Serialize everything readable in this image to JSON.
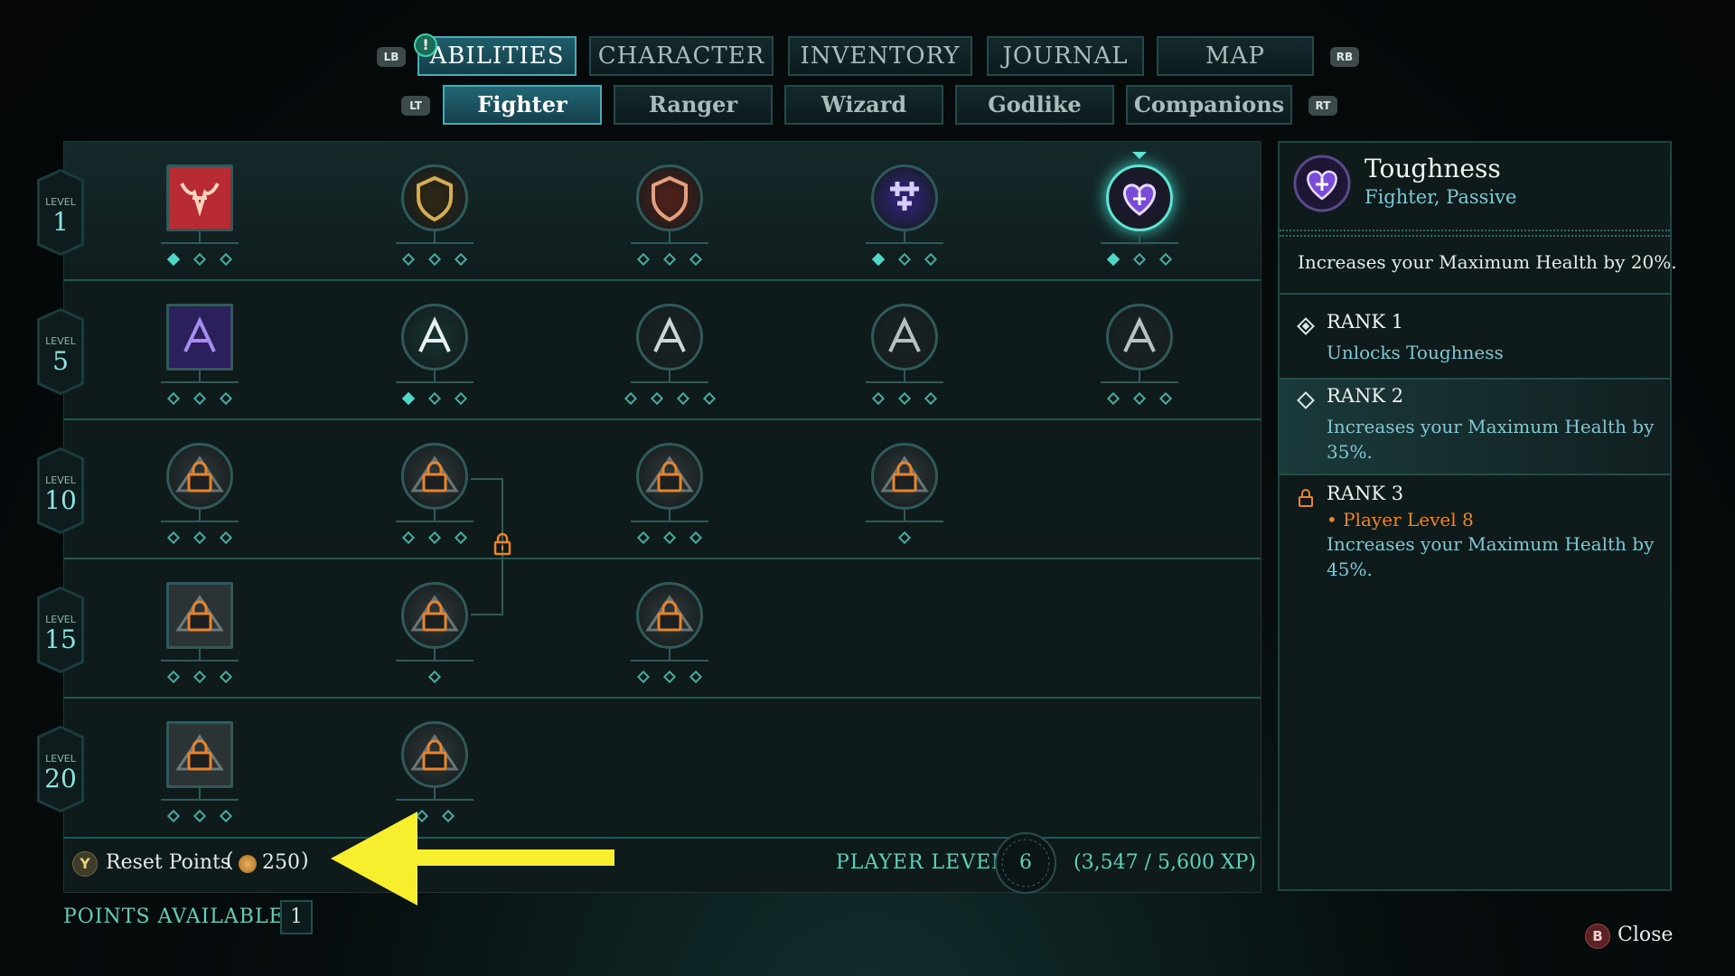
{
  "top_tabs": {
    "lb": "LB",
    "rb": "RB",
    "notification": "!",
    "items": [
      {
        "label": "ABILITIES",
        "active": true
      },
      {
        "label": "CHARACTER",
        "active": false
      },
      {
        "label": "INVENTORY",
        "active": false
      },
      {
        "label": "JOURNAL",
        "active": false
      },
      {
        "label": "MAP",
        "active": false
      }
    ]
  },
  "sub_tabs": {
    "lt": "LT",
    "rt": "RT",
    "items": [
      {
        "label": "Fighter",
        "active": true
      },
      {
        "label": "Ranger",
        "active": false
      },
      {
        "label": "Wizard",
        "active": false
      },
      {
        "label": "Godlike",
        "active": false
      },
      {
        "label": "Companions",
        "active": false
      }
    ]
  },
  "levels": [
    {
      "word": "LEVEL",
      "num": "1"
    },
    {
      "word": "LEVEL",
      "num": "5"
    },
    {
      "word": "LEVEL",
      "num": "10"
    },
    {
      "word": "LEVEL",
      "num": "15"
    },
    {
      "word": "LEVEL",
      "num": "20"
    }
  ],
  "abilities": [
    {
      "icon": "bull-rage-icon",
      "shape": "square",
      "ranks": 3,
      "filled": 1,
      "locked": false
    },
    {
      "icon": "golden-shield-icon",
      "shape": "circle",
      "ranks": 3,
      "filled": 0,
      "locked": false
    },
    {
      "icon": "shield-bash-icon",
      "shape": "circle",
      "ranks": 3,
      "filled": 0,
      "locked": false
    },
    {
      "icon": "purple-crosses-icon",
      "shape": "circle",
      "ranks": 3,
      "filled": 1,
      "locked": false
    },
    {
      "icon": "heart-toughness-icon",
      "shape": "circle",
      "ranks": 3,
      "filled": 1,
      "locked": false,
      "selected": true
    },
    {
      "icon": "purple-dash-icon",
      "shape": "square",
      "ranks": 3,
      "filled": 0,
      "locked": false
    },
    {
      "icon": "torn-banner-icon",
      "shape": "circle",
      "ranks": 3,
      "filled": 1,
      "locked": false
    },
    {
      "icon": "fist-strike-icon",
      "shape": "circle",
      "ranks": 4,
      "filled": 0,
      "locked": false
    },
    {
      "icon": "skull-sword-icon",
      "shape": "circle",
      "ranks": 3,
      "filled": 0,
      "locked": false
    },
    {
      "icon": "double-axe-icon",
      "shape": "circle",
      "ranks": 3,
      "filled": 0,
      "locked": false
    },
    {
      "icon": "locked-ability-icon",
      "shape": "circle",
      "ranks": 3,
      "filled": 0,
      "locked": true
    },
    {
      "icon": "locked-shield-icon",
      "shape": "circle",
      "ranks": 3,
      "filled": 0,
      "locked": true
    },
    {
      "icon": "locked-ability-icon",
      "shape": "circle",
      "ranks": 3,
      "filled": 0,
      "locked": true
    },
    {
      "icon": "locked-ability-icon",
      "shape": "circle",
      "ranks": 1,
      "filled": 0,
      "locked": true
    },
    {
      "icon": "locked-ability-icon",
      "shape": "square",
      "ranks": 3,
      "filled": 0,
      "locked": true
    },
    {
      "icon": "locked-ability-icon",
      "shape": "circle",
      "ranks": 1,
      "filled": 0,
      "locked": true
    },
    {
      "icon": "locked-ability-icon",
      "shape": "circle",
      "ranks": 3,
      "filled": 0,
      "locked": true
    },
    {
      "icon": "locked-ability-icon",
      "shape": "square",
      "ranks": 3,
      "filled": 0,
      "locked": true
    },
    {
      "icon": "locked-ability-icon",
      "shape": "circle",
      "ranks": 2,
      "filled": 0,
      "locked": true
    }
  ],
  "footer": {
    "reset_button": "Y",
    "reset_label": "Reset Points",
    "reset_cost_open": "(",
    "reset_cost": "250",
    "reset_cost_close": ")",
    "player_level_label": "PLAYER LEVEL",
    "player_level": "6",
    "xp": "(3,547 / 5,600 XP)",
    "points_label": "POINTS AVAILABLE",
    "points_value": "1"
  },
  "detail": {
    "title": "Toughness",
    "subtitle": "Fighter, Passive",
    "description": "Increases your Maximum Health by 20%.",
    "ranks": [
      {
        "label": "RANK 1",
        "lines": [
          "Unlocks Toughness"
        ]
      },
      {
        "label": "RANK 2",
        "lines": [
          "Increases your Maximum Health by",
          "35%."
        ]
      },
      {
        "label": "RANK 3",
        "requirement": "• Player Level 8",
        "lines": [
          "Increases your Maximum Health by",
          "45%."
        ]
      }
    ]
  },
  "close": {
    "button": "B",
    "label": "Close"
  },
  "colors": {
    "accent": "#4fd6c6",
    "lock": "#e8842c",
    "annotation_arrow": "#f7ef2e"
  }
}
